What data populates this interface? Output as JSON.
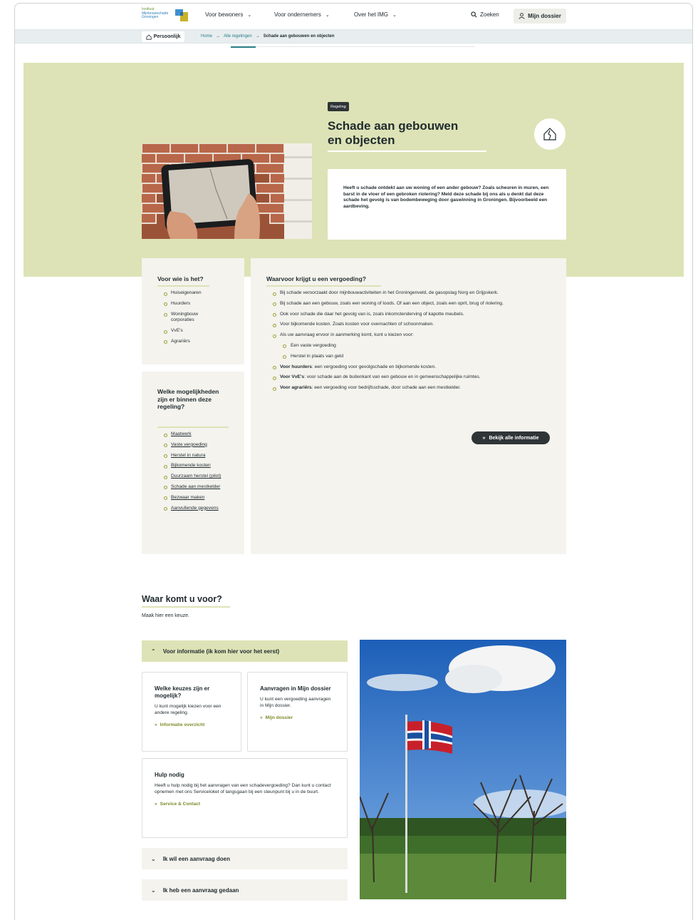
{
  "header": {
    "logo_lines": [
      "Instituut",
      "Mijnbouwschade",
      "Groningen"
    ],
    "nav": [
      {
        "label": "Voor bewoners"
      },
      {
        "label": "Voor ondernemers"
      },
      {
        "label": "Over het IMG"
      }
    ],
    "search_label": "Zoeken",
    "dossier_label": "Mijn dossier"
  },
  "breadcrumb": {
    "mode_label": "Persoonlijk",
    "items": [
      "Home",
      "Alle regelingen",
      "Schade aan gebouwen en objecten"
    ]
  },
  "hero": {
    "badge": "Regeling",
    "title_line1": "Schade aan gebouwen",
    "title_line2": "en objecten",
    "intro": "Heeft u schade ontdekt aan uw woning of een ander gebouw? Zoals scheuren in muren, een barst in de vloer of een gebroken riolering? Meld deze schade bij ons als u denkt dat deze schade het gevolg is van bodembeweging door gaswinning in Groningen. Bijvoorbeeld een aardbeving."
  },
  "voor_wie": {
    "heading": "Voor wie is het?",
    "items": [
      "Huiseigenaren",
      "Huurders",
      "Woningbouw corporaties",
      "VvE's",
      "Agrariërs"
    ]
  },
  "mogelijkheden": {
    "heading": "Welke mogelijkheden zijn er binnen deze regeling?",
    "items": [
      "Maatwerk",
      "Vaste vergoeding",
      "Herstel in natura",
      "Bijkomende kosten",
      "Duurzaam herstel (pilot)",
      "Schade aan mestkelder",
      "Bezwaar maken",
      "Aanvullende gegevens"
    ]
  },
  "vergoeding": {
    "heading": "Waarvoor krijgt u een vergoeding?",
    "items": [
      {
        "bold": "",
        "text": "Bij schade veroorzaakt door mijnbouwactiviteiten in het Groningenveld, de gasopslag Norg en Grijpskerk."
      },
      {
        "bold": "",
        "text": "Bij schade aan een gebouw, zoals een woning of loods. Of aan een object, zoals een oprit, brug of riolering."
      },
      {
        "bold": "",
        "text": "Ook voor schade die daar het gevolg van is, zoals inkomstenderving of kapotte meubels."
      },
      {
        "bold": "",
        "text": "Voor bijkomende kosten. Zoals kosten voor overnachten of schoonmaken."
      },
      {
        "bold": "",
        "text": "Als uw aanvraag ervoor in aanmerking komt, kunt u kiezen voor:"
      },
      {
        "bold": "",
        "text": "Een vaste vergoeding",
        "sub": true
      },
      {
        "bold": "",
        "text": "Herstel in plaats van geld",
        "sub": true
      },
      {
        "bold": "Voor huurders",
        "text": ": een vergoeding voor gevolgschade en bijkomende kosten."
      },
      {
        "bold": "Voor VvE's",
        "text": ": voor schade aan de buitenkant van een gebouw en in gemeenschappelijke ruimtes."
      },
      {
        "bold": "Voor agrariërs",
        "text": ": een vergoeding voor bedrijfsschade, door schade aan een mestkelder."
      }
    ],
    "more_button": "Bekijk alle informatie"
  },
  "waar": {
    "title": "Waar komt u voor?",
    "subtitle": "Maak hier een keuze.",
    "accordion_open": "Voor informatie (ik kom hier voor het eerst)",
    "cards": [
      {
        "title": "Welke keuzes zijn er mogelijk?",
        "text": "U kunt mogelijk kiezen voor een andere regeling.",
        "link": "Informatie overzicht"
      },
      {
        "title": "Aanvragen in Mijn dossier",
        "text": "U kunt een vergoeding aanvragen in Mijn dossier.",
        "link": "Mijn dossier"
      },
      {
        "title": "Hulp nodig",
        "text": "Heeft u hulp nodig bij het aanvragen van een schadevergoeding? Dan kunt u contact opnemen met ons Serviceloket of langsgaan bij een steunpunt bij u in de buurt.",
        "link": "Service & Contact"
      }
    ],
    "accordion_closed": [
      "Ik wil een aanvraag doen",
      "Ik heb een aanvraag gedaan"
    ]
  },
  "colors": {
    "accent_green": "#dde3b6",
    "dark": "#2f3437",
    "link_teal": "#2a7d86",
    "panel": "#f4f3ee"
  }
}
